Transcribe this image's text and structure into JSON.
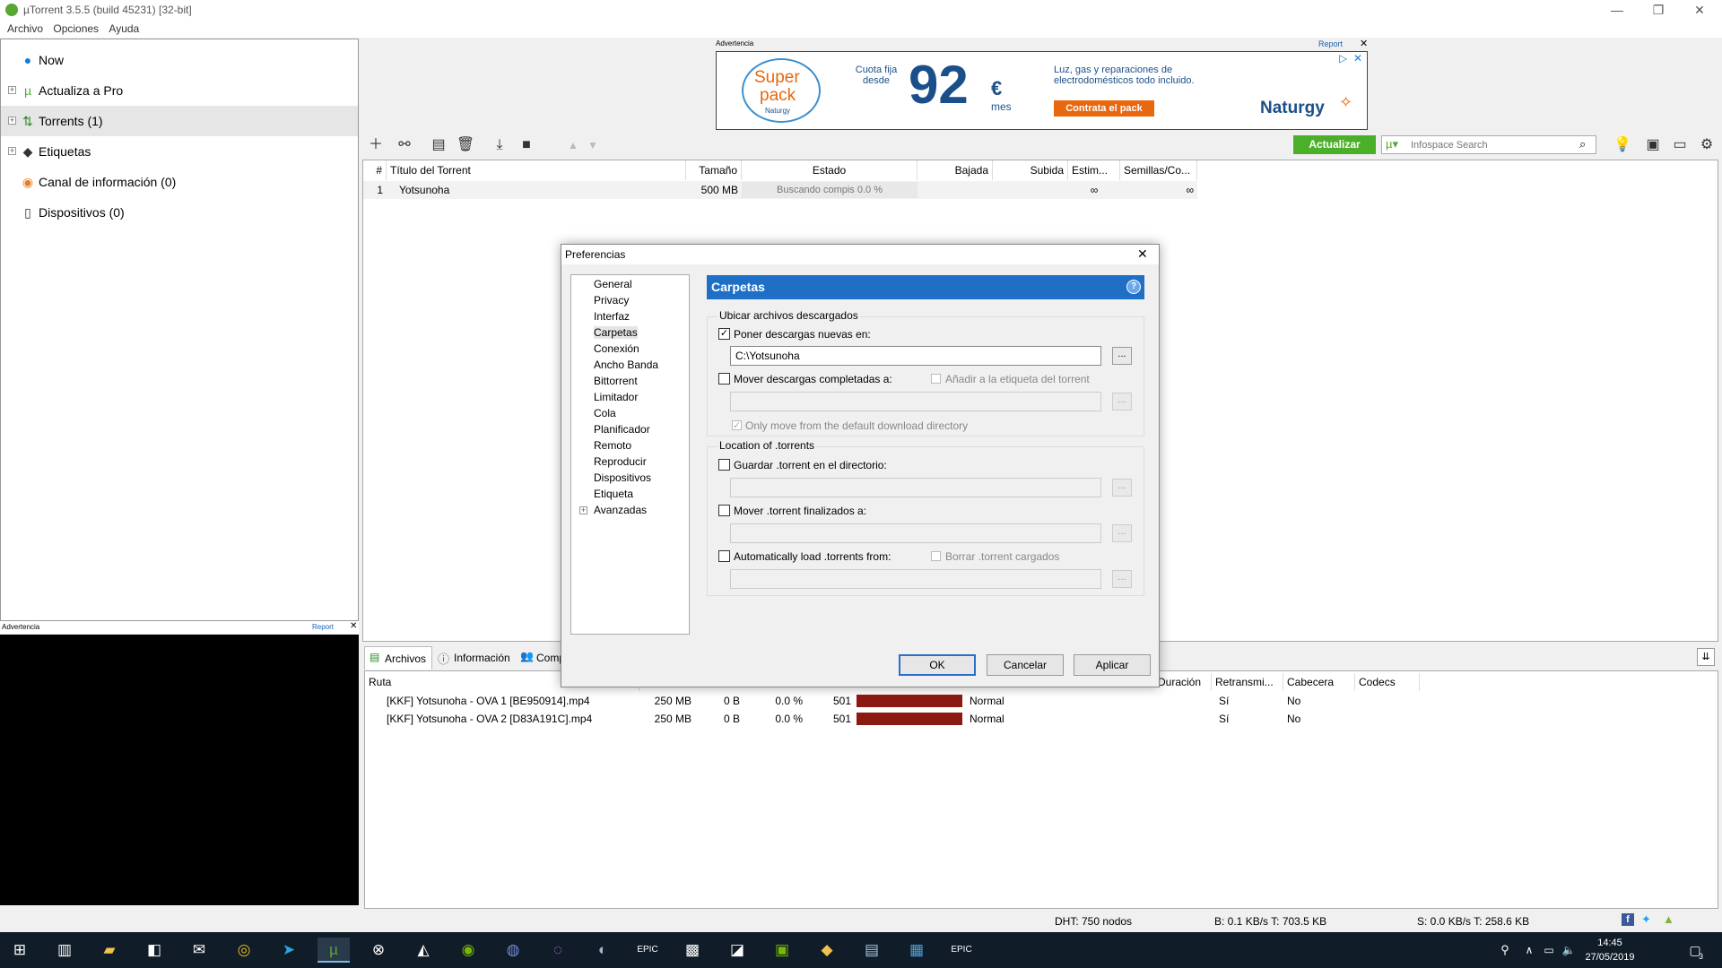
{
  "window": {
    "title": "µTorrent 3.5.5  (build 45231) [32-bit]",
    "min": "—",
    "max": "❐",
    "close": "✕"
  },
  "menu": [
    "Archivo",
    "Opciones",
    "Ayuda"
  ],
  "sidebar": {
    "items": [
      {
        "label": "Now"
      },
      {
        "label": "Actualiza a Pro"
      },
      {
        "label": "Torrents (1)"
      },
      {
        "label": "Etiquetas"
      },
      {
        "label": "Canal de información (0)"
      },
      {
        "label": "Dispositivos (0)"
      }
    ]
  },
  "left_ad": {
    "label": "Advertencia",
    "report": "Report",
    "close": "✕"
  },
  "top_ad": {
    "label": "Advertencia",
    "report": "Report",
    "close": "✕",
    "logo_line1": "Super",
    "logo_line2": "pack",
    "logo_brand": "Naturgy",
    "price_prefix": "Cuota fija desde",
    "price": "92",
    "currency": "€",
    "period": "mes",
    "headline": "Luz, gas y reparaciones de electrodomésticos todo incluido.",
    "cta": "Contrata el pack",
    "brand": "Naturgy"
  },
  "toolbar": {
    "update_button": "Actualizar",
    "search_placeholder": "Infospace Search"
  },
  "torrent_list": {
    "columns": [
      "#",
      "Título del Torrent",
      "Tamaño",
      "Estado",
      "Bajada",
      "Subida",
      "Estim...",
      "Semillas/Co..."
    ],
    "rows": [
      {
        "num": "1",
        "name": "Yotsunoha",
        "size": "500 MB",
        "status": "Buscando compis 0.0 %",
        "eta": "∞",
        "seeds": "∞"
      }
    ]
  },
  "dialog": {
    "title": "Preferencias",
    "close": "✕",
    "tree": [
      "General",
      "Privacy",
      "Interfaz",
      "Carpetas",
      "Conexión",
      "Ancho Banda",
      "Bittorrent",
      "Limitador",
      "Cola",
      "Planificador",
      "Remoto",
      "Reproducir",
      "Dispositivos",
      "Etiqueta",
      "Avanzadas"
    ],
    "panel_title": "Carpetas",
    "help": "?",
    "group1_label": "Ubicar archivos descargados",
    "put_new": "Poner descargas nuevas en:",
    "put_new_path": "C:\\Yotsunoha",
    "move_completed": "Mover descargas completadas a:",
    "add_label": "Añadir a la etiqueta del torrent",
    "only_move": "Only move from the default download directory",
    "group2_label": "Location of .torrents",
    "save_torrent": "Guardar .torrent en el directorio:",
    "move_torrent": "Mover .torrent finalizados a:",
    "auto_load": "Automatically load .torrents from:",
    "delete_loaded": "Borrar .torrent cargados",
    "browse": "...",
    "ok": "OK",
    "cancel": "Cancelar",
    "apply": "Aplicar"
  },
  "bottom_tabs": [
    "Archivos",
    "Información",
    "Comp"
  ],
  "files": {
    "columns": [
      "Ruta",
      "Duración",
      "Retransmi...",
      "Cabecera",
      "Codecs"
    ],
    "rows": [
      {
        "name": "[KKF] Yotsunoha - OVA 1 [BE950914].mp4",
        "size": "250 MB",
        "done": "0 B",
        "pct": "0.0 %",
        "pieces": "501",
        "priority": "Normal",
        "stream": "Sí",
        "header": "No"
      },
      {
        "name": "[KKF] Yotsunoha - OVA 2 [D83A191C].mp4",
        "size": "250 MB",
        "done": "0 B",
        "pct": "0.0 %",
        "pieces": "501",
        "priority": "Normal",
        "stream": "Sí",
        "header": "No"
      }
    ]
  },
  "status": {
    "dht": "DHT: 750 nodos",
    "down": "B: 0.1 KB/s T: 703.5 KB",
    "up": "S: 0.0 KB/s T: 258.6 KB"
  },
  "taskbar": {
    "time": "14:45",
    "date": "27/05/2019",
    "notifications": "3"
  },
  "colors": {
    "accent": "#1f6fc6",
    "update_button": "#4caf2a",
    "progress_bar": "#8b1a12",
    "taskbar": "#101c27"
  }
}
